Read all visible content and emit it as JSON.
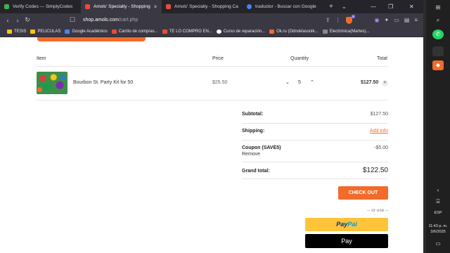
{
  "tabs": [
    {
      "label": "Verify Codes — SimplyCodes",
      "color": "#3bb54a",
      "active": false
    },
    {
      "label": "Amols' Specialty - Shopping Cart",
      "color": "#e84c3d",
      "active": true
    },
    {
      "label": "Amols' Specialty - Shopping Cart",
      "color": "#e84c3d",
      "active": false
    },
    {
      "label": "traductor - Buscar con Google",
      "color": "#4285f4",
      "active": false
    }
  ],
  "url": {
    "host": "shop.amols.com",
    "path": "/cart.php"
  },
  "shield_count": "9",
  "bookmarks": [
    {
      "label": "TESIS",
      "color": "#f5c518"
    },
    {
      "label": "PELICULAS",
      "color": "#f5c518"
    },
    {
      "label": "Google Académico",
      "color": "#4285f4"
    },
    {
      "label": "Carrito de compras...",
      "color": "#e84c3d"
    },
    {
      "label": "TE LO COMPRO EN...",
      "color": "#e84c3d"
    },
    {
      "label": "Curso de reparación...",
      "color": "#ffffff"
    },
    {
      "label": "Ok.ru (Odnoklassnik...",
      "color": "#f26b2a"
    },
    {
      "label": "Electrónica(Martes)...",
      "color": "#888888"
    }
  ],
  "cart": {
    "headers": {
      "item": "Item",
      "price": "Price",
      "quantity": "Quantity",
      "total": "Total"
    },
    "item": {
      "name": "Bourbon St. Party Kit for 50",
      "price": "$25.50",
      "quantity": "5",
      "total": "$127.50"
    }
  },
  "summary": {
    "subtotal_label": "Subtotal:",
    "subtotal_value": "$127.50",
    "shipping_label": "Shipping:",
    "shipping_link": "Add Info",
    "coupon_label": "Coupon (SAVE5)",
    "coupon_value": "-$5.00",
    "coupon_remove": "Remove",
    "grand_label": "Grand total:",
    "grand_value": "$122.50"
  },
  "checkout_label": "CHECK OUT",
  "or_use": "-- or use --",
  "paypal": {
    "pay": "Pay",
    "pal": "Pal"
  },
  "applepay_label": "Pay",
  "taskbar": {
    "lang": "ESP",
    "time": "11:43 p. m.",
    "date": "3/6/2025"
  },
  "colors": {
    "accent": "#f26b2a",
    "paypal": "#ffc439"
  }
}
